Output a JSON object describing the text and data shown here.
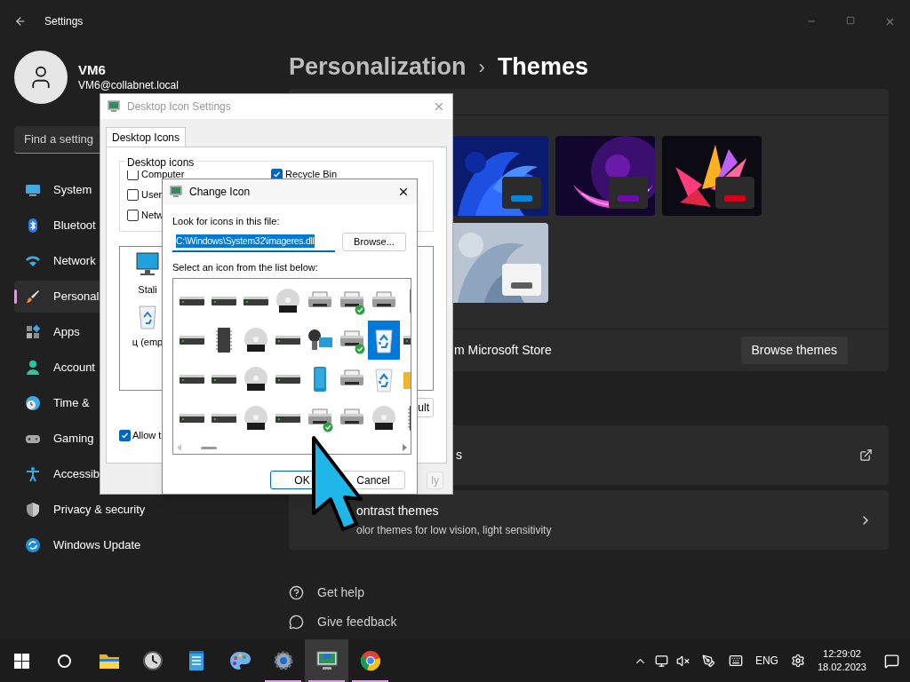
{
  "settings": {
    "title": "Settings",
    "user": {
      "name": "VM6",
      "email": "VM6@collabnet.local"
    },
    "search": {
      "placeholder": "Find a setting"
    },
    "nav": [
      {
        "label": "System",
        "selected": false
      },
      {
        "label": "Bluetoot",
        "selected": false
      },
      {
        "label": "Network",
        "selected": false
      },
      {
        "label": "Personal",
        "selected": true
      },
      {
        "label": "Apps",
        "selected": false
      },
      {
        "label": "Account",
        "selected": false
      },
      {
        "label": "Time &",
        "selected": false
      },
      {
        "label": "Gaming",
        "selected": false
      },
      {
        "label": "Accessib",
        "selected": false
      },
      {
        "label": "Privacy & security",
        "selected": false
      },
      {
        "label": "Windows Update",
        "selected": false
      }
    ],
    "breadcrumb": {
      "parent": "Personalization",
      "separator": "›",
      "current": "Themes"
    },
    "themes": [
      {
        "kind": "bloom",
        "color": "#0a84d8"
      },
      {
        "kind": "glow",
        "color": "#6b0fa8"
      },
      {
        "kind": "flower",
        "color": "#d4001a"
      },
      {
        "kind": "light",
        "color": "#5d5d5d"
      }
    ],
    "store_row": {
      "label": "m Microsoft Store",
      "button": "Browse themes"
    },
    "links": [
      {
        "kind": "external",
        "title": "s"
      },
      {
        "kind": "chevron",
        "title": "ontrast themes",
        "subtitle": "olor themes for low vision, light sensitivity"
      }
    ],
    "help": [
      {
        "label": "Get help"
      },
      {
        "label": "Give feedback"
      }
    ]
  },
  "desktop_icon_settings": {
    "title": "Desktop Icon Settings",
    "tab": {
      "label": "Desktop Icons",
      "selected": true
    },
    "group_label": "Desktop icons",
    "checkboxes": [
      {
        "label": "Computer",
        "checked": false
      },
      {
        "label": "User",
        "checked": false
      },
      {
        "label": "Netw",
        "checked": false
      },
      {
        "label": "Recycle Bin",
        "checked": true
      }
    ],
    "icons": [
      {
        "kind": "monitor",
        "label": "Stali"
      },
      {
        "kind": "recycle",
        "label": "ц (emp"
      }
    ],
    "restore_button": "ult",
    "allow": {
      "label": "Allow t",
      "checked": true
    },
    "apply_button": "ly"
  },
  "change_icon": {
    "title": "Change Icon",
    "file_label": "Look for icons in this file:",
    "file_path": "C:\\Windows\\System32\\imageres.dll",
    "browse_button": "Browse...",
    "list_label": "Select an icon from the list below:",
    "icons": [
      {
        "kind": "drive",
        "ok": false,
        "selected": false
      },
      {
        "kind": "drive",
        "ok": false,
        "selected": false
      },
      {
        "kind": "drive",
        "ok": false,
        "selected": false
      },
      {
        "kind": "disc",
        "ok": false,
        "selected": false
      },
      {
        "kind": "printer",
        "ok": false,
        "selected": false
      },
      {
        "kind": "printer",
        "ok": true,
        "selected": false
      },
      {
        "kind": "printer",
        "ok": false,
        "selected": false
      },
      {
        "kind": "phone",
        "selected": false
      },
      {
        "kind": "drive",
        "ok": false,
        "selected": false
      },
      {
        "kind": "chip",
        "ok": false,
        "selected": false
      },
      {
        "kind": "disc",
        "ok": false,
        "selected": false
      },
      {
        "kind": "drive",
        "ok": false,
        "selected": false
      },
      {
        "kind": "camera",
        "ok": false,
        "selected": false
      },
      {
        "kind": "printer",
        "ok": true,
        "selected": false
      },
      {
        "kind": "recycle",
        "ok": false,
        "selected": true
      },
      {
        "kind": "drive",
        "selected": false
      },
      {
        "kind": "drive",
        "ok": false,
        "selected": false
      },
      {
        "kind": "drive",
        "ok": false,
        "selected": false
      },
      {
        "kind": "disc",
        "ok": false,
        "selected": false
      },
      {
        "kind": "drive",
        "ok": false,
        "selected": false
      },
      {
        "kind": "phone",
        "ok": false,
        "selected": false
      },
      {
        "kind": "printer",
        "ok": false,
        "selected": false
      },
      {
        "kind": "recycle",
        "ok": false,
        "selected": false
      },
      {
        "kind": "folder",
        "selected": false
      },
      {
        "kind": "drive",
        "ok": false,
        "selected": false
      },
      {
        "kind": "drive",
        "ok": false,
        "selected": false
      },
      {
        "kind": "disc",
        "ok": false,
        "selected": false
      },
      {
        "kind": "drive",
        "ok": false,
        "selected": false
      },
      {
        "kind": "printer",
        "ok": true,
        "selected": false
      },
      {
        "kind": "printer",
        "ok": false,
        "selected": false
      },
      {
        "kind": "disc",
        "ok": false,
        "selected": false
      },
      {
        "kind": "chip",
        "selected": false
      }
    ],
    "ok_button": "OK",
    "cancel_button": "Cancel"
  },
  "taskbar": {
    "apps": [
      {
        "running": false,
        "selected": false
      },
      {
        "running": false,
        "selected": false
      },
      {
        "running": false,
        "selected": false
      },
      {
        "running": false,
        "selected": false
      },
      {
        "running": true,
        "selected": false
      },
      {
        "running": true,
        "selected": true
      },
      {
        "running": true,
        "selected": false
      }
    ],
    "language": "ENG",
    "time": "12:29:02",
    "date": "18.02.2023"
  }
}
